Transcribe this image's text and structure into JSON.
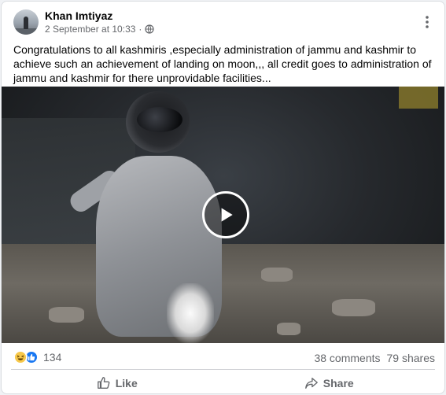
{
  "post": {
    "author": "Khan Imtiyaz",
    "date": "2 September at 10:33",
    "date_separator": "·",
    "privacy_icon": "globe-icon",
    "caption": "Congratulations to all kashmiris ,especially administration of jammu and kashmir to achieve such an achievement of landing on moon,,, all credit goes to administration of jammu and kashmir for there unprovidable facilities...",
    "video": {
      "play_icon": "play-icon"
    }
  },
  "stats": {
    "reactions_count": "134",
    "comments": "38 comments",
    "shares": "79 shares",
    "reaction_icons": [
      "haha-icon",
      "like-icon"
    ]
  },
  "actions": {
    "like_label": "Like",
    "share_label": "Share"
  },
  "colors": {
    "brand_blue": "#1877f2",
    "secondary_text": "#65676b",
    "haha_yellow": "#f7c84a"
  }
}
